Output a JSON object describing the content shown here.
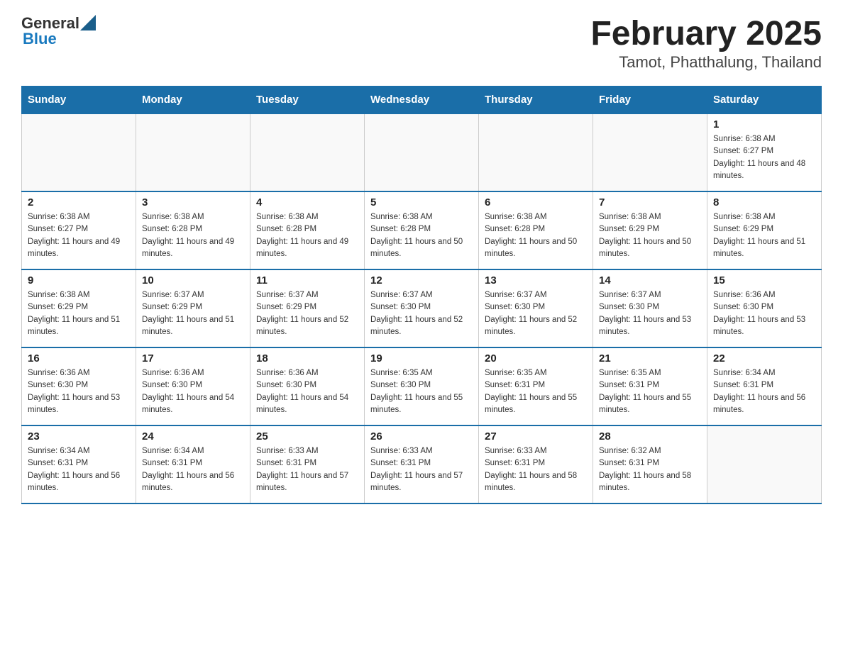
{
  "header": {
    "logo_general": "General",
    "logo_blue": "Blue",
    "title": "February 2025",
    "subtitle": "Tamot, Phatthalung, Thailand"
  },
  "weekdays": [
    "Sunday",
    "Monday",
    "Tuesday",
    "Wednesday",
    "Thursday",
    "Friday",
    "Saturday"
  ],
  "weeks": [
    [
      {
        "day": "",
        "sunrise": "",
        "sunset": "",
        "daylight": ""
      },
      {
        "day": "",
        "sunrise": "",
        "sunset": "",
        "daylight": ""
      },
      {
        "day": "",
        "sunrise": "",
        "sunset": "",
        "daylight": ""
      },
      {
        "day": "",
        "sunrise": "",
        "sunset": "",
        "daylight": ""
      },
      {
        "day": "",
        "sunrise": "",
        "sunset": "",
        "daylight": ""
      },
      {
        "day": "",
        "sunrise": "",
        "sunset": "",
        "daylight": ""
      },
      {
        "day": "1",
        "sunrise": "Sunrise: 6:38 AM",
        "sunset": "Sunset: 6:27 PM",
        "daylight": "Daylight: 11 hours and 48 minutes."
      }
    ],
    [
      {
        "day": "2",
        "sunrise": "Sunrise: 6:38 AM",
        "sunset": "Sunset: 6:27 PM",
        "daylight": "Daylight: 11 hours and 49 minutes."
      },
      {
        "day": "3",
        "sunrise": "Sunrise: 6:38 AM",
        "sunset": "Sunset: 6:28 PM",
        "daylight": "Daylight: 11 hours and 49 minutes."
      },
      {
        "day": "4",
        "sunrise": "Sunrise: 6:38 AM",
        "sunset": "Sunset: 6:28 PM",
        "daylight": "Daylight: 11 hours and 49 minutes."
      },
      {
        "day": "5",
        "sunrise": "Sunrise: 6:38 AM",
        "sunset": "Sunset: 6:28 PM",
        "daylight": "Daylight: 11 hours and 50 minutes."
      },
      {
        "day": "6",
        "sunrise": "Sunrise: 6:38 AM",
        "sunset": "Sunset: 6:28 PM",
        "daylight": "Daylight: 11 hours and 50 minutes."
      },
      {
        "day": "7",
        "sunrise": "Sunrise: 6:38 AM",
        "sunset": "Sunset: 6:29 PM",
        "daylight": "Daylight: 11 hours and 50 minutes."
      },
      {
        "day": "8",
        "sunrise": "Sunrise: 6:38 AM",
        "sunset": "Sunset: 6:29 PM",
        "daylight": "Daylight: 11 hours and 51 minutes."
      }
    ],
    [
      {
        "day": "9",
        "sunrise": "Sunrise: 6:38 AM",
        "sunset": "Sunset: 6:29 PM",
        "daylight": "Daylight: 11 hours and 51 minutes."
      },
      {
        "day": "10",
        "sunrise": "Sunrise: 6:37 AM",
        "sunset": "Sunset: 6:29 PM",
        "daylight": "Daylight: 11 hours and 51 minutes."
      },
      {
        "day": "11",
        "sunrise": "Sunrise: 6:37 AM",
        "sunset": "Sunset: 6:29 PM",
        "daylight": "Daylight: 11 hours and 52 minutes."
      },
      {
        "day": "12",
        "sunrise": "Sunrise: 6:37 AM",
        "sunset": "Sunset: 6:30 PM",
        "daylight": "Daylight: 11 hours and 52 minutes."
      },
      {
        "day": "13",
        "sunrise": "Sunrise: 6:37 AM",
        "sunset": "Sunset: 6:30 PM",
        "daylight": "Daylight: 11 hours and 52 minutes."
      },
      {
        "day": "14",
        "sunrise": "Sunrise: 6:37 AM",
        "sunset": "Sunset: 6:30 PM",
        "daylight": "Daylight: 11 hours and 53 minutes."
      },
      {
        "day": "15",
        "sunrise": "Sunrise: 6:36 AM",
        "sunset": "Sunset: 6:30 PM",
        "daylight": "Daylight: 11 hours and 53 minutes."
      }
    ],
    [
      {
        "day": "16",
        "sunrise": "Sunrise: 6:36 AM",
        "sunset": "Sunset: 6:30 PM",
        "daylight": "Daylight: 11 hours and 53 minutes."
      },
      {
        "day": "17",
        "sunrise": "Sunrise: 6:36 AM",
        "sunset": "Sunset: 6:30 PM",
        "daylight": "Daylight: 11 hours and 54 minutes."
      },
      {
        "day": "18",
        "sunrise": "Sunrise: 6:36 AM",
        "sunset": "Sunset: 6:30 PM",
        "daylight": "Daylight: 11 hours and 54 minutes."
      },
      {
        "day": "19",
        "sunrise": "Sunrise: 6:35 AM",
        "sunset": "Sunset: 6:30 PM",
        "daylight": "Daylight: 11 hours and 55 minutes."
      },
      {
        "day": "20",
        "sunrise": "Sunrise: 6:35 AM",
        "sunset": "Sunset: 6:31 PM",
        "daylight": "Daylight: 11 hours and 55 minutes."
      },
      {
        "day": "21",
        "sunrise": "Sunrise: 6:35 AM",
        "sunset": "Sunset: 6:31 PM",
        "daylight": "Daylight: 11 hours and 55 minutes."
      },
      {
        "day": "22",
        "sunrise": "Sunrise: 6:34 AM",
        "sunset": "Sunset: 6:31 PM",
        "daylight": "Daylight: 11 hours and 56 minutes."
      }
    ],
    [
      {
        "day": "23",
        "sunrise": "Sunrise: 6:34 AM",
        "sunset": "Sunset: 6:31 PM",
        "daylight": "Daylight: 11 hours and 56 minutes."
      },
      {
        "day": "24",
        "sunrise": "Sunrise: 6:34 AM",
        "sunset": "Sunset: 6:31 PM",
        "daylight": "Daylight: 11 hours and 56 minutes."
      },
      {
        "day": "25",
        "sunrise": "Sunrise: 6:33 AM",
        "sunset": "Sunset: 6:31 PM",
        "daylight": "Daylight: 11 hours and 57 minutes."
      },
      {
        "day": "26",
        "sunrise": "Sunrise: 6:33 AM",
        "sunset": "Sunset: 6:31 PM",
        "daylight": "Daylight: 11 hours and 57 minutes."
      },
      {
        "day": "27",
        "sunrise": "Sunrise: 6:33 AM",
        "sunset": "Sunset: 6:31 PM",
        "daylight": "Daylight: 11 hours and 58 minutes."
      },
      {
        "day": "28",
        "sunrise": "Sunrise: 6:32 AM",
        "sunset": "Sunset: 6:31 PM",
        "daylight": "Daylight: 11 hours and 58 minutes."
      },
      {
        "day": "",
        "sunrise": "",
        "sunset": "",
        "daylight": ""
      }
    ]
  ]
}
